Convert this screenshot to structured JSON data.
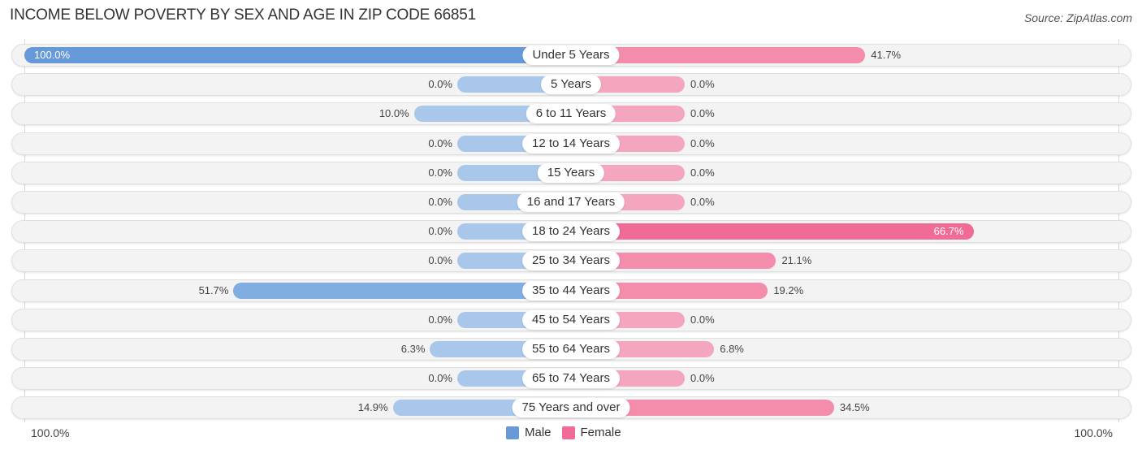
{
  "header": {
    "title": "INCOME BELOW POVERTY BY SEX AND AGE IN ZIP CODE 66851",
    "source": "Source: ZipAtlas.com"
  },
  "colors": {
    "male": "#6699d8",
    "male_light": "#a9c7ea",
    "female": "#f06b95",
    "female_light": "#f5a6bf"
  },
  "chart_data": {
    "type": "bar",
    "orientation": "horizontal-diverging",
    "title": "INCOME BELOW POVERTY BY SEX AND AGE IN ZIP CODE 66851",
    "categories": [
      "Under 5 Years",
      "5 Years",
      "6 to 11 Years",
      "12 to 14 Years",
      "15 Years",
      "16 and 17 Years",
      "18 to 24 Years",
      "25 to 34 Years",
      "35 to 44 Years",
      "45 to 54 Years",
      "55 to 64 Years",
      "65 to 74 Years",
      "75 Years and over"
    ],
    "series": [
      {
        "name": "Male",
        "values": [
          100.0,
          0.0,
          10.0,
          0.0,
          0.0,
          0.0,
          0.0,
          0.0,
          51.7,
          0.0,
          6.3,
          0.0,
          14.9
        ],
        "labels": [
          "100.0%",
          "0.0%",
          "10.0%",
          "0.0%",
          "0.0%",
          "0.0%",
          "0.0%",
          "0.0%",
          "51.7%",
          "0.0%",
          "6.3%",
          "0.0%",
          "14.9%"
        ]
      },
      {
        "name": "Female",
        "values": [
          41.7,
          0.0,
          0.0,
          0.0,
          0.0,
          0.0,
          66.7,
          21.1,
          19.2,
          0.0,
          6.8,
          0.0,
          34.5
        ],
        "labels": [
          "41.7%",
          "0.0%",
          "0.0%",
          "0.0%",
          "0.0%",
          "0.0%",
          "66.7%",
          "21.1%",
          "19.2%",
          "0.0%",
          "6.8%",
          "0.0%",
          "34.5%"
        ]
      }
    ],
    "xlim": [
      -100,
      100
    ],
    "axis_left_label": "100.0%",
    "axis_right_label": "100.0%",
    "legend": {
      "position": "bottom-center",
      "entries": [
        "Male",
        "Female"
      ]
    },
    "xlabel": "",
    "ylabel": ""
  }
}
